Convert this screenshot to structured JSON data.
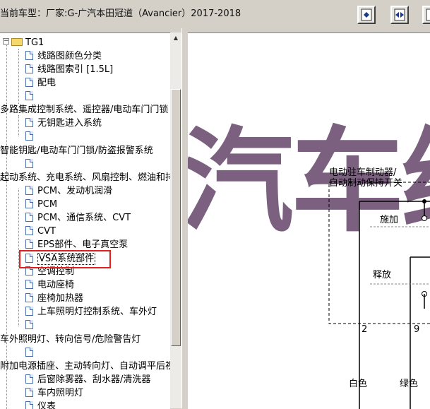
{
  "title": "当前车型：厂家:G-广汽本田冠道（Avancier）2017-2018",
  "toolbar": {
    "buttons": [
      "fit-page-icon",
      "fit-width-icon",
      "next-icon"
    ]
  },
  "tree": {
    "root": "TG1",
    "items": [
      {
        "label": "线路图颜色分类",
        "type": "doc"
      },
      {
        "label": "线路图索引 [1.5L]",
        "type": "doc"
      },
      {
        "label": "配电",
        "type": "doc"
      },
      {
        "label": "",
        "type": "doc"
      },
      {
        "label": "多路集成控制系统、遥控器/电动车门门锁",
        "type": "section"
      },
      {
        "label": "无钥匙进入系统",
        "type": "doc"
      },
      {
        "label": "",
        "type": "doc"
      },
      {
        "label": "智能钥匙/电动车门门锁/防盗报警系统",
        "type": "section"
      },
      {
        "label": "",
        "type": "doc"
      },
      {
        "label": "起动系统、充电系统、风扇控制、燃油和排",
        "type": "section"
      },
      {
        "label": "PCM、发动机润滑",
        "type": "doc"
      },
      {
        "label": "PCM",
        "type": "doc"
      },
      {
        "label": "PCM、通信系统、CVT",
        "type": "doc"
      },
      {
        "label": "CVT",
        "type": "doc"
      },
      {
        "label": "EPS部件、电子真空泵",
        "type": "doc"
      },
      {
        "label": "VSA系统部件",
        "type": "doc",
        "selected": true
      },
      {
        "label": "空调控制",
        "type": "doc"
      },
      {
        "label": "电动座椅",
        "type": "doc"
      },
      {
        "label": "座椅加热器",
        "type": "doc"
      },
      {
        "label": "上车照明灯控制系统、车外灯",
        "type": "doc"
      },
      {
        "label": "",
        "type": "doc"
      },
      {
        "label": "车外照明灯、转向信号/危险警告灯",
        "type": "section"
      },
      {
        "label": "",
        "type": "doc"
      },
      {
        "label": "附加电源插座、主动转向灯、自动调平后视",
        "type": "section"
      },
      {
        "label": "后窗除雾器、刮水器/清洗器",
        "type": "doc"
      },
      {
        "label": "车内照明灯",
        "type": "doc"
      },
      {
        "label": "仪表",
        "type": "doc"
      }
    ]
  },
  "diagram": {
    "watermark": "汽车维",
    "switch_title_1": "电动驻车制动器/",
    "switch_title_2": "自动制动保持开关",
    "apply": "施加",
    "release": "释放",
    "pin_a": "2",
    "pin_b": "9",
    "wire_a": "白色",
    "wire_b": "绿色"
  },
  "colors": {
    "highlight_box": "#e0201e",
    "watermark": "#7b6080",
    "window_bg": "#d4d0c8"
  }
}
